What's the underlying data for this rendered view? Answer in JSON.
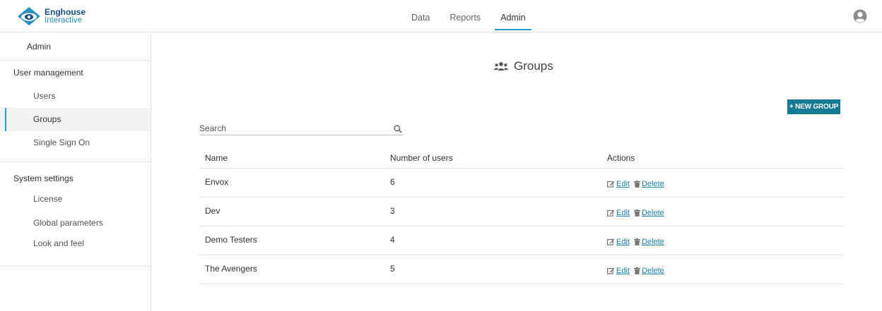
{
  "brand": {
    "line1": "Enghouse",
    "line2": "Interactive"
  },
  "nav": {
    "tabs": [
      {
        "label": "Data"
      },
      {
        "label": "Reports"
      },
      {
        "label": "Admin"
      }
    ],
    "active": "Admin"
  },
  "sidebar": {
    "header": "Admin",
    "sections": [
      {
        "title": "User management",
        "items": [
          "Users",
          "Groups",
          "Single Sign On"
        ]
      },
      {
        "title": "System settings",
        "items": [
          "License",
          "Global parameters",
          "Look and feel"
        ]
      }
    ],
    "active_item": "Groups"
  },
  "main": {
    "title": "Groups",
    "new_button": "+ NEW GROUP",
    "search_placeholder": "Search",
    "table": {
      "headers": {
        "name": "Name",
        "users": "Number of users",
        "actions": "Actions"
      },
      "rows": [
        {
          "name": "Envox",
          "users": "6"
        },
        {
          "name": "Dev",
          "users": "3"
        },
        {
          "name": "Demo Testers",
          "users": "4"
        },
        {
          "name": "The Avengers",
          "users": "5"
        }
      ],
      "edit_label": "Edit",
      "delete_label": "Delete"
    }
  },
  "colors": {
    "accent": "#2b9bc2",
    "button": "#157a96",
    "link": "#1e7fa8",
    "brand_dark": "#1a4f86"
  }
}
